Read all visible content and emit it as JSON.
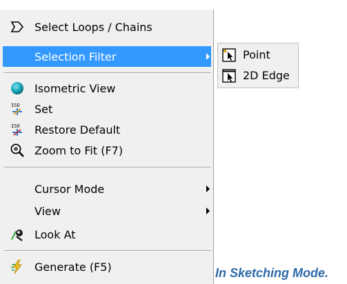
{
  "menu": {
    "items": [
      {
        "label": "Select Loops / Chains",
        "icon": "select-loops-icon"
      },
      {
        "label": "Selection Filter",
        "icon": "",
        "submenu": true
      },
      {
        "label": "Isometric View",
        "icon": "isometric-view-icon"
      },
      {
        "label": "Set",
        "icon": "iso-set-icon"
      },
      {
        "label": "Restore Default",
        "icon": "iso-restore-icon"
      },
      {
        "label": "Zoom to Fit (F7)",
        "icon": "zoom-to-fit-icon"
      },
      {
        "label": "Cursor Mode",
        "icon": "",
        "submenu": true
      },
      {
        "label": "View",
        "icon": "",
        "submenu": true
      },
      {
        "label": "Look At",
        "icon": "look-at-icon"
      },
      {
        "label": "Generate (F5)",
        "icon": "generate-icon"
      }
    ]
  },
  "submenu": {
    "items": [
      {
        "label": "Point",
        "icon": "point-filter-icon"
      },
      {
        "label": "2D Edge",
        "icon": "edge-filter-icon"
      }
    ]
  },
  "caption": "In Sketching Mode.",
  "colors": {
    "highlight": "#3399ff",
    "menu_bg": "#f0f0f0",
    "caption": "#2e6aa8"
  }
}
